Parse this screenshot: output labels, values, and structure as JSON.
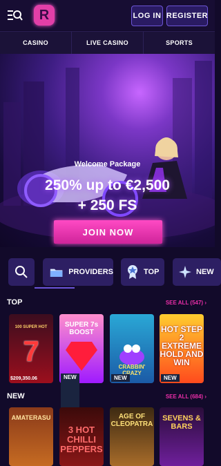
{
  "header": {
    "login_label": "LOG IN",
    "register_label": "REGISTER",
    "logo_text": "R"
  },
  "nav": {
    "items": [
      "CASINO",
      "LIVE CASINO",
      "SPORTS"
    ]
  },
  "hero": {
    "welcome": "Welcome Package",
    "offer_line1": "250% up to €2,500",
    "offer_line2": "+ 250 FS",
    "join_label": "JOIN NOW"
  },
  "chips": {
    "providers": "PROVIDERS",
    "top": "TOP",
    "new": "NEW"
  },
  "top": {
    "title": "TOP",
    "see_all": "SEE ALL (547)",
    "jackpot": "$209,350.06",
    "new_badge": "NEW",
    "games": [
      "100 SUPER HOT",
      "SUPER 7s BOOST",
      "CRABBIN' CRAZY",
      "HOT STEP 2 EXTREME HOLD AND WIN"
    ]
  },
  "new": {
    "title": "NEW",
    "see_all": "SEE ALL (684)",
    "games": [
      "AMATERASU",
      "3 HOT CHILLI PEPPERS",
      "AGE OF CLEOPATRA",
      "SEVENS & BARS"
    ]
  },
  "colors": {
    "accent": "#e23fa8",
    "background": "#120a2a",
    "nav": "#1b1238"
  }
}
